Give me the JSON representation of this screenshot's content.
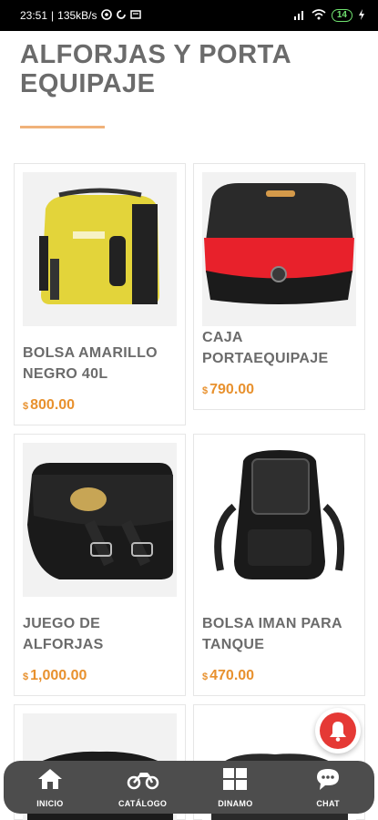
{
  "status_bar": {
    "time": "23:51",
    "network_speed": "135kB/s",
    "battery": "14"
  },
  "page": {
    "title": "ALFORJAS Y PORTA EQUIPAJE"
  },
  "products": [
    {
      "name": "BOLSA AMARILLO NEGRO 40L",
      "currency": "$",
      "price": "800.00",
      "image_icon": "yellow-bag-image"
    },
    {
      "name": "CAJA PORTAEQUIPAJE",
      "currency": "$",
      "price": "790.00",
      "image_icon": "top-case-image"
    },
    {
      "name": "JUEGO DE ALFORJAS",
      "currency": "$",
      "price": "1,000.00",
      "image_icon": "saddlebag-image"
    },
    {
      "name": "BOLSA IMAN PARA TANQUE",
      "currency": "$",
      "price": "470.00",
      "image_icon": "tank-bag-image"
    }
  ],
  "bottom_nav": [
    {
      "label": "INICIO",
      "icon": "home-icon"
    },
    {
      "label": "CATÁLOGO",
      "icon": "motorcycle-icon"
    },
    {
      "label": "DINAMO",
      "icon": "grid-icon"
    },
    {
      "label": "CHAT",
      "icon": "chat-icon"
    }
  ],
  "colors": {
    "accent": "#e8912e",
    "underline": "#f0b27a",
    "nav_bg": "#4d4d4d",
    "bell": "#e53935"
  }
}
